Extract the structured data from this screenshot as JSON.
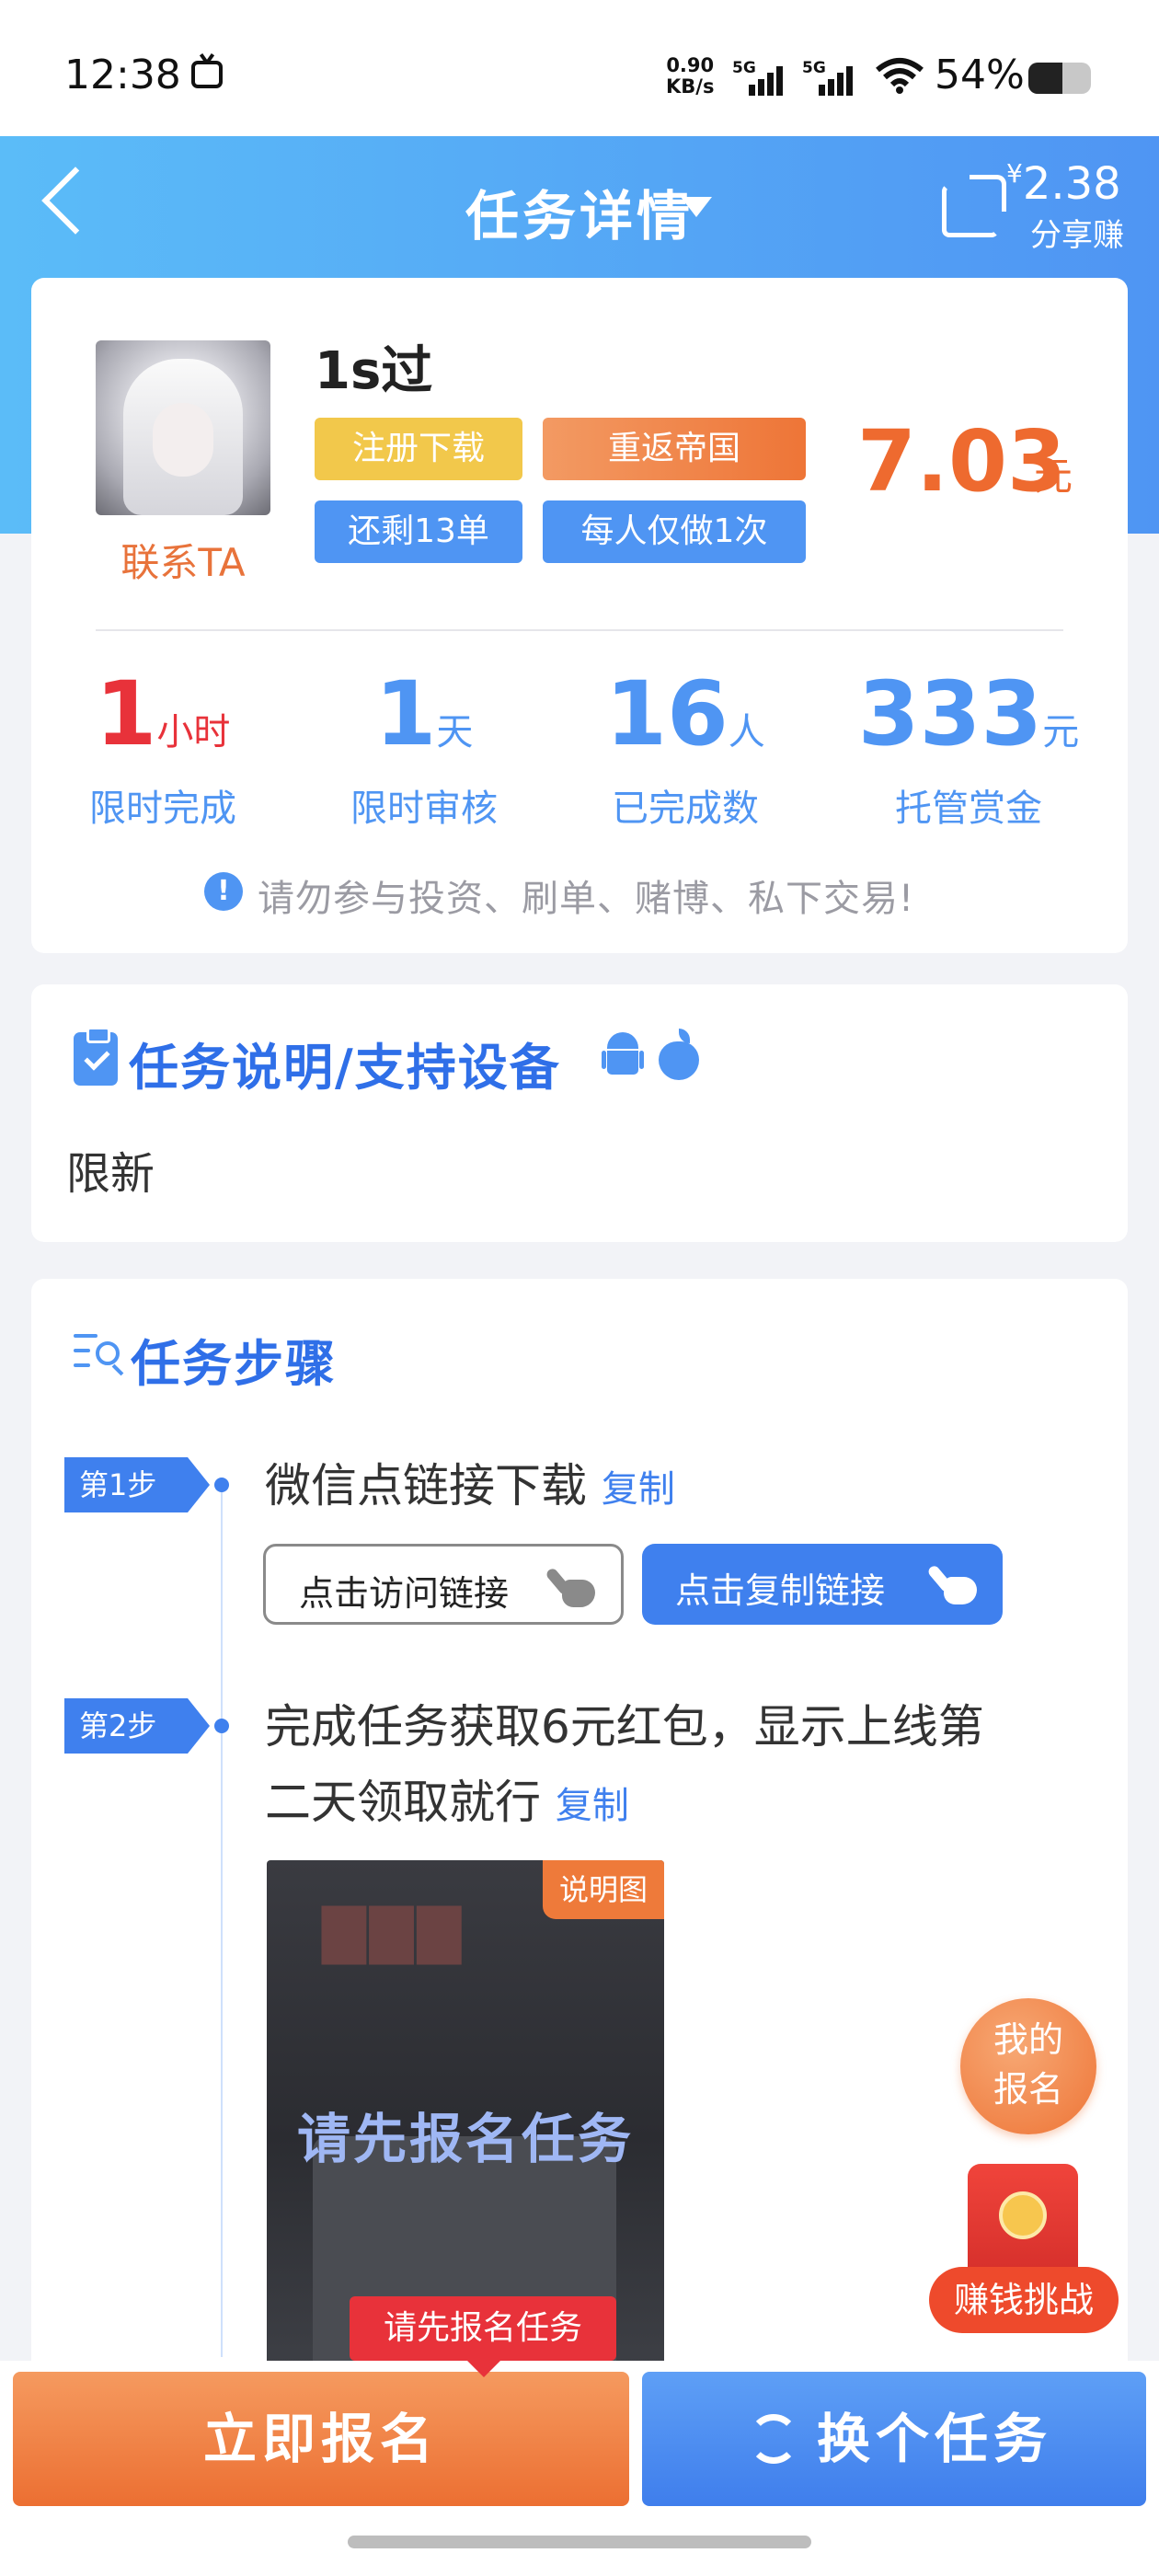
{
  "status_bar": {
    "time": "12:38",
    "net_speed_value": "0.90",
    "net_speed_unit": "KB/s",
    "sim1_label": "5G",
    "sim2_label": "5G",
    "battery_text": "54%",
    "battery_level": 0.54
  },
  "header": {
    "title": "任务详情",
    "share_price": "2.38",
    "share_currency": "¥",
    "share_label": "分享赚"
  },
  "task": {
    "name": "1s过",
    "contact_label": "联系TA",
    "tags": [
      "注册下载",
      "重返帝国",
      "还剩13单",
      "每人仅做1次"
    ],
    "price": "7.03",
    "price_unit": "元"
  },
  "stats": [
    {
      "value": "1",
      "unit": "小时",
      "label": "限时完成",
      "color": "#e8323a"
    },
    {
      "value": "1",
      "unit": "天",
      "label": "限时审核",
      "color": "#4f95f3"
    },
    {
      "value": "16",
      "unit": "人",
      "label": "已完成数",
      "color": "#4f95f3"
    },
    {
      "value": "333",
      "unit": "元",
      "label": "托管赏金",
      "color": "#4f95f3"
    }
  ],
  "warning": {
    "icon": "!",
    "text": "请勿参与投资、刷单、赌博、私下交易!"
  },
  "description": {
    "title": "任务说明/支持设备",
    "text": "限新"
  },
  "steps_section": {
    "title": "任务步骤",
    "steps": [
      {
        "badge": "第1步",
        "text": "微信点链接下载",
        "copy_label": "复制",
        "visit_button": "点击访问链接",
        "copy_button": "点击复制链接"
      },
      {
        "badge": "第2步",
        "text_line1": "完成任务获取6元红包，显示上线第",
        "text_line2": "二天领取就行",
        "copy_label": "复制",
        "image_badge": "说明图",
        "image_overlay": "请先报名任务"
      }
    ]
  },
  "floating": {
    "my_signup_line1": "我的",
    "my_signup_line2": "报名",
    "challenge_label": "赚钱挑战"
  },
  "tooltip": "请先报名任务",
  "bottom": {
    "signup_button": "立即报名",
    "switch_button": "换个任务"
  },
  "colors": {
    "primary_blue": "#4f95f3",
    "accent_orange": "#ee6a2f",
    "alert_red": "#e8323a"
  }
}
